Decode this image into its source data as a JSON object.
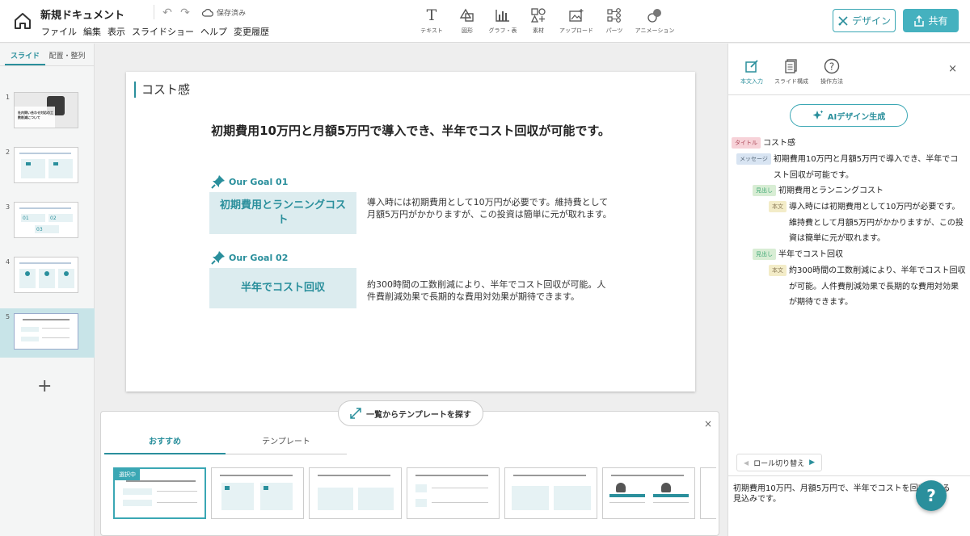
{
  "doc": {
    "title": "新規ドキュメント",
    "saved": "保存済み"
  },
  "menu": [
    "ファイル",
    "編集",
    "表示",
    "スライドショー",
    "ヘルプ",
    "変更履歴"
  ],
  "toolbar": [
    {
      "label": "テキスト",
      "icon": "text-icon"
    },
    {
      "label": "図形",
      "icon": "shape-icon"
    },
    {
      "label": "グラフ・表",
      "icon": "chart-icon"
    },
    {
      "label": "素材",
      "icon": "assets-icon"
    },
    {
      "label": "アップロード",
      "icon": "upload-icon"
    },
    {
      "label": "パーツ",
      "icon": "parts-icon"
    },
    {
      "label": "アニメーション",
      "icon": "animation-icon"
    }
  ],
  "header_buttons": {
    "design": "デザイン",
    "share": "共有"
  },
  "left": {
    "tabs": [
      "スライド",
      "配置・整列"
    ],
    "slides": [
      {
        "num": "1",
        "caption": "社内問い合わせ対応の工数削減について"
      },
      {
        "num": "2"
      },
      {
        "num": "3"
      },
      {
        "num": "4"
      },
      {
        "num": "5"
      }
    ],
    "add": "+"
  },
  "slide": {
    "title": "コスト感",
    "message": "初期費用10万円と月額5万円で導入でき、半年でコスト回収が可能です。",
    "goals": [
      {
        "label": "Our Goal 01",
        "heading": "初期費用とランニングコスト",
        "body": "導入時には初期費用として10万円が必要です。維持費として月額5万円がかかりますが、この投資は簡単に元が取れます。"
      },
      {
        "label": "Our Goal 02",
        "heading": "半年でコスト回収",
        "body": "約300時間の工数削減により、半年でコスト回収が可能。人件費削減効果で長期的な費用対効果が期待できます。"
      }
    ]
  },
  "templates": {
    "find_button": "一覧からテンプレートを探す",
    "tabs": [
      "おすすめ",
      "テンプレート"
    ],
    "selected_badge": "選択中",
    "close": "×"
  },
  "right": {
    "tabs": [
      "本文入力",
      "スライド構成",
      "操作方法"
    ],
    "close": "×",
    "ai_button": "AIデザイン生成",
    "outline": [
      {
        "tag": "タイトル",
        "kind": "title",
        "text": "コスト感"
      },
      {
        "tag": "メッセージ",
        "kind": "msg",
        "text": "初期費用10万円と月額5万円で導入でき、半年でコスト回収が可能です。"
      },
      {
        "tag": "見出し",
        "kind": "head",
        "text": "初期費用とランニングコスト"
      },
      {
        "tag": "本文",
        "kind": "body",
        "text": "導入時には初期費用として10万円が必要です。維持費として月額5万円がかかりますが、この投資は簡単に元が取れます。"
      },
      {
        "tag": "見出し",
        "kind": "head",
        "text": "半年でコスト回収"
      },
      {
        "tag": "本文",
        "kind": "body",
        "text": "約300時間の工数削減により、半年でコスト回収が可能。人件費削減効果で長期的な費用対効果が期待できます。"
      }
    ],
    "role_button": "ロール切り替え",
    "preview": "初期費用10万円、月額5万円で、半年でコストを回収できる見込みです。"
  },
  "help": "?",
  "colors": {
    "accent": "#2a8f9c",
    "accent_light": "#dcecef",
    "share_bg": "#45b1bf"
  }
}
